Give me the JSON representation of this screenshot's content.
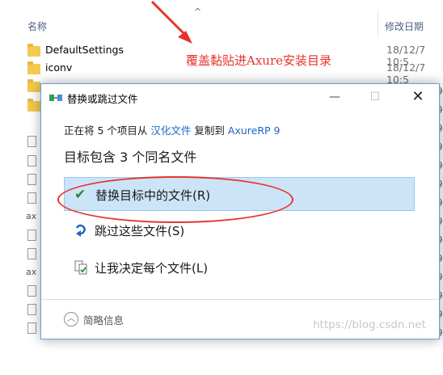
{
  "explorer": {
    "col_name": "名称",
    "col_date": "修改日期",
    "rows": [
      {
        "name": "DefaultSettings",
        "date": "18/12/7 10:5"
      },
      {
        "name": "iconv",
        "date": "18/12/7 10:5"
      }
    ],
    "left_fragments": [
      "ax",
      "ax"
    ],
    "date_fragments": [
      "9",
      "9",
      "9",
      "9",
      "9",
      "9",
      "9",
      "9",
      "9",
      "9",
      "9",
      "9",
      "9",
      "9"
    ]
  },
  "annotation": "覆盖黏贴进Axure安装目录",
  "dialog": {
    "title": "替换或跳过文件",
    "copy_prefix": "正在将 5 个项目从",
    "copy_source": "汉化文件",
    "copy_middle": "复制到",
    "copy_target": "AxureRP 9",
    "heading": "目标包含 3 个同名文件",
    "options": [
      {
        "label": "替换目标中的文件(R)",
        "icon": "checkmark-icon"
      },
      {
        "label": "跳过这些文件(S)",
        "icon": "skip-arrow-icon"
      },
      {
        "label": "让我决定每个文件(L)",
        "icon": "decide-files-icon"
      }
    ],
    "more_info": "简略信息",
    "watermark": "https://blog.csdn.net"
  },
  "colors": {
    "accent": "#1a66c5",
    "selected_bg": "#cce4f7",
    "annotation_red": "#e8332a",
    "check_green": "#1f8a3b"
  }
}
